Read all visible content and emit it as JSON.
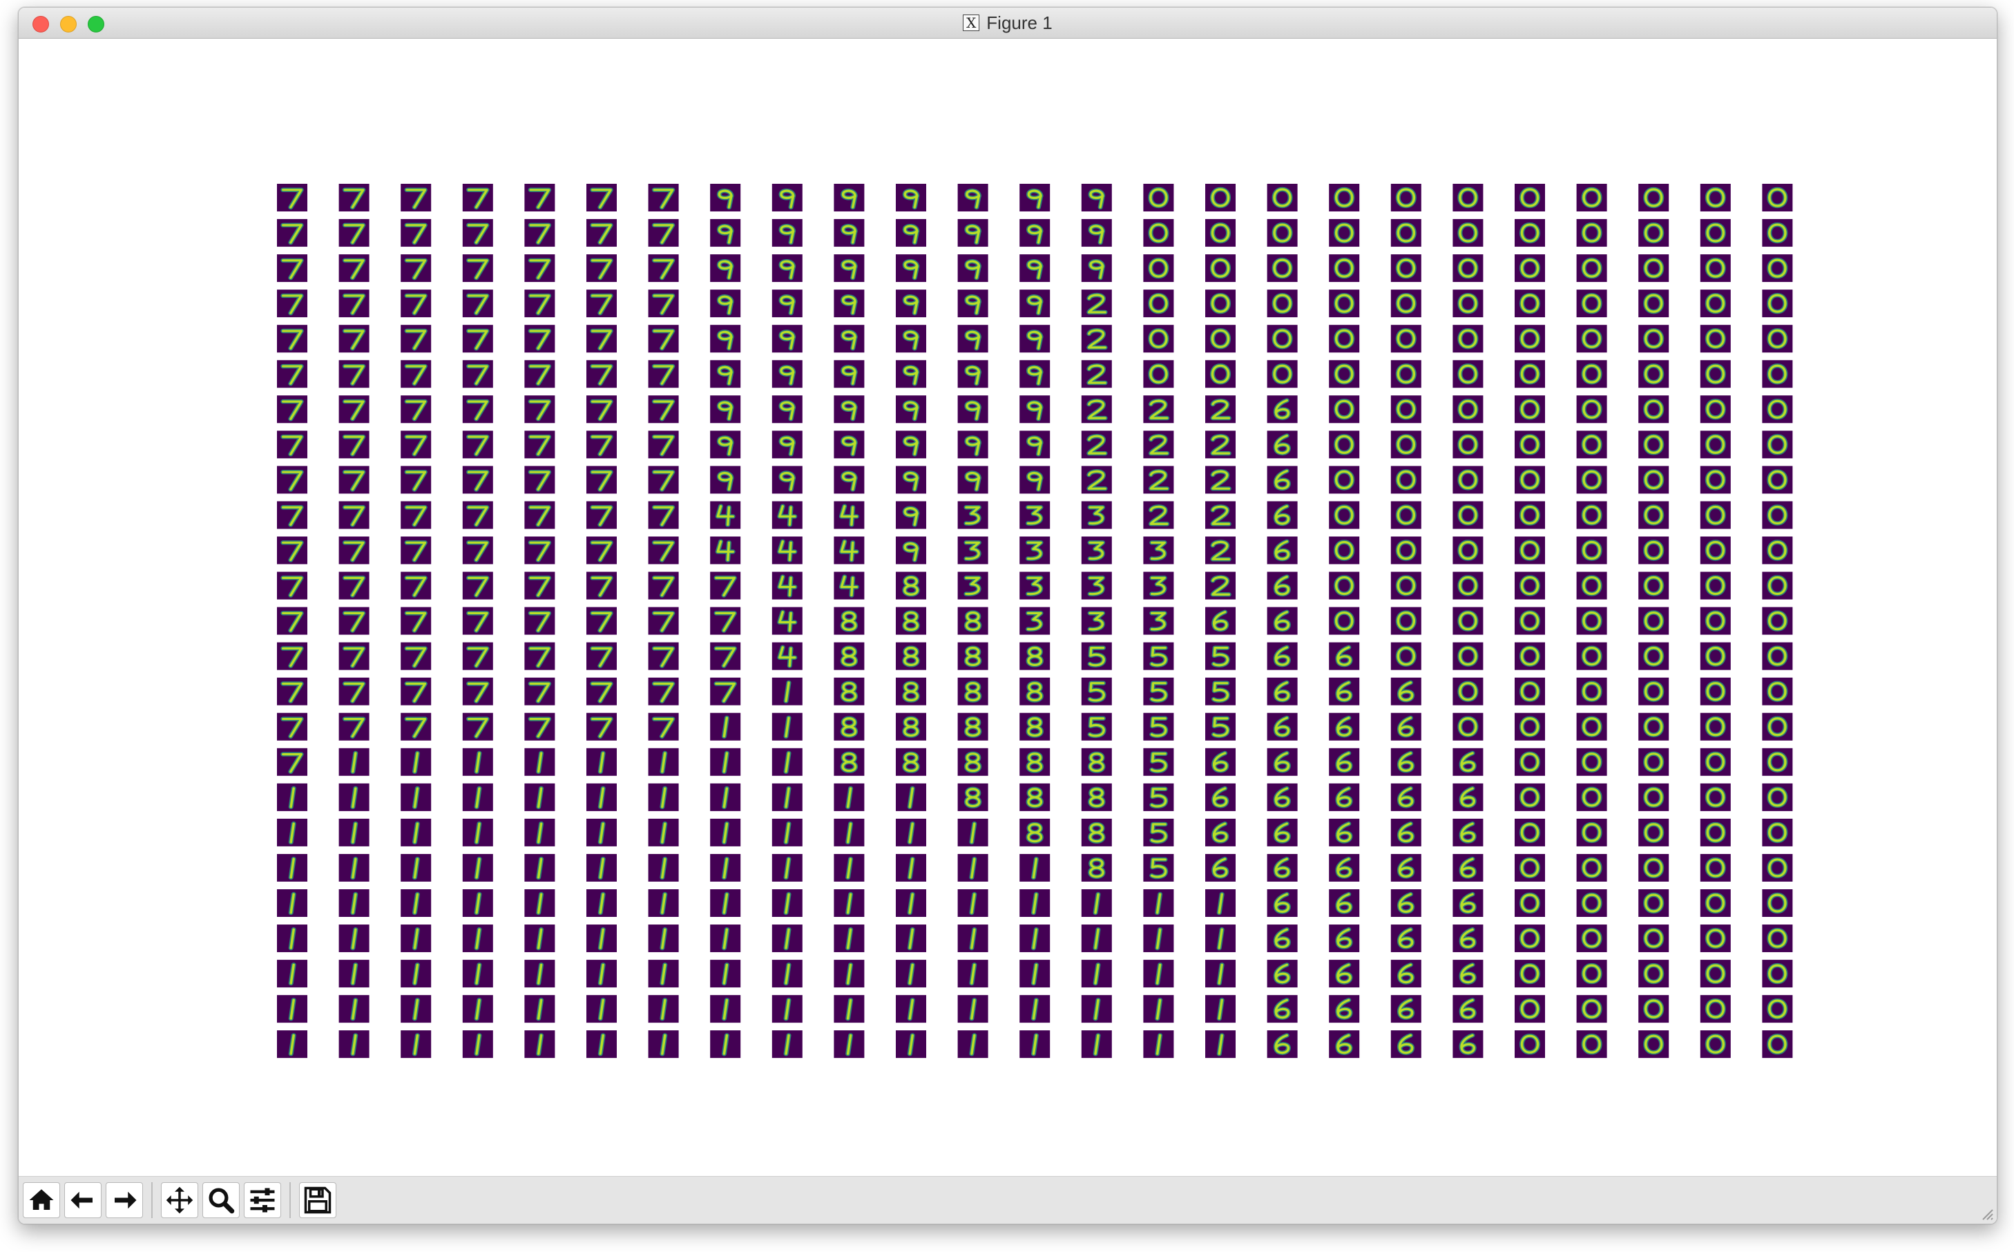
{
  "window": {
    "title": "Figure 1",
    "title_icon": "x11-icon"
  },
  "figure": {
    "type": "image-grid",
    "rows": 25,
    "cols": 25,
    "colormap": "viridis",
    "cell_bg": "#440154",
    "stroke_color": "#b9de28",
    "glow_color": "#22a884",
    "digit_rows": [
      "7777777999999900000000000",
      "7777777999999900000000000",
      "7777777999999900000000000",
      "7777777999999200000000000",
      "7777777999999200000000000",
      "7777777999999200000000000",
      "7777777999999222600000000",
      "7777777999999222600000000",
      "7777777999999222600000000",
      "7777777444933322600000000",
      "7777777444933332600000000",
      "7777777744833332600000000",
      "7777777748883336600000000",
      "7777777748888555660000000",
      "7777777718888555666000000",
      "7777777118888555666000000",
      "7111111118888856666600000",
      "1111111111188856666600000",
      "1111111111118856666600000",
      "1111111111111856666600000",
      "1111111111111111666600000",
      "1111111111111111666600000",
      "1111111111111111666600000",
      "1111111111111111666600000",
      "1111111111111111666600000"
    ]
  },
  "toolbar": {
    "buttons": [
      {
        "name": "home-button",
        "icon": "home-icon"
      },
      {
        "name": "back-button",
        "icon": "arrow-left-icon"
      },
      {
        "name": "forward-button",
        "icon": "arrow-right-icon"
      },
      {
        "name": "pan-button",
        "icon": "move-icon"
      },
      {
        "name": "zoom-button",
        "icon": "magnifier-icon"
      },
      {
        "name": "configure-subplots-button",
        "icon": "sliders-icon"
      },
      {
        "name": "save-button",
        "icon": "floppy-disk-icon"
      }
    ]
  }
}
